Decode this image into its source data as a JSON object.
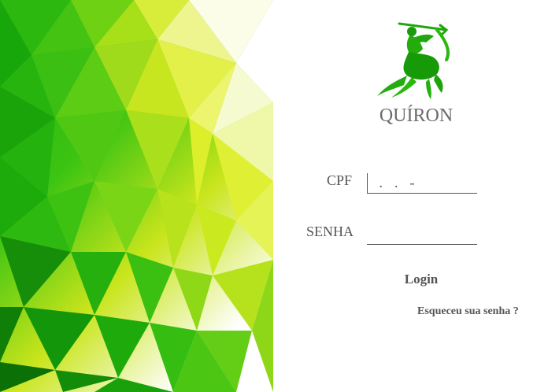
{
  "brand": {
    "name": "QUÍRON",
    "logo_icon": "archer-centaur-icon",
    "logo_color": "#1fa70b"
  },
  "form": {
    "cpf_label": "CPF",
    "cpf_value": " .  .  -",
    "senha_label": "SENHA",
    "senha_value": "",
    "login_label": "Login",
    "forgot_label": "Esqueceu sua senha ?"
  },
  "colors": {
    "accent_green": "#1fae0a",
    "lime": "#c9e51c",
    "text": "#555555"
  }
}
